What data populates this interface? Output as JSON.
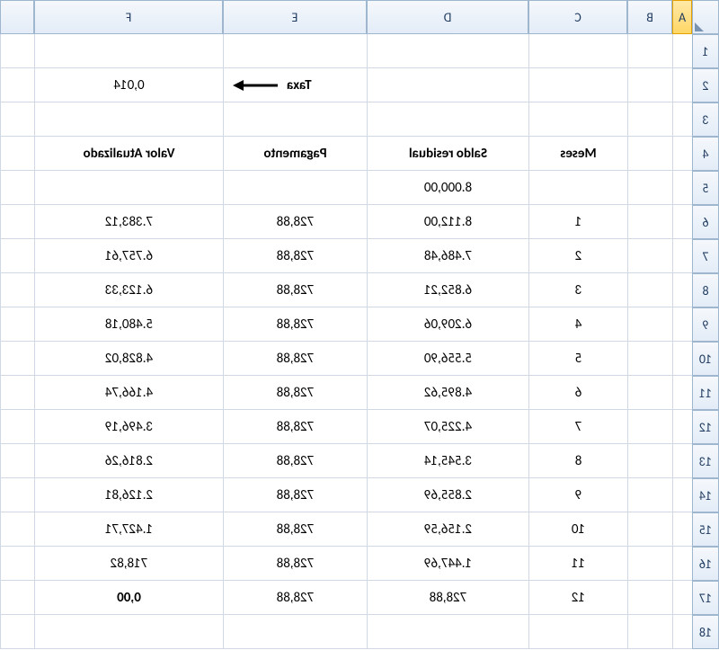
{
  "columns": [
    "A",
    "B",
    "C",
    "D",
    "E",
    "F",
    ""
  ],
  "rows": [
    "1",
    "2",
    "3",
    "4",
    "5",
    "6",
    "7",
    "8",
    "9",
    "10",
    "11",
    "12",
    "13",
    "14",
    "15",
    "16",
    "17",
    "18"
  ],
  "taxa_label": "Taxa",
  "taxa_value": "0,014",
  "headers": {
    "c": "Meses",
    "d": "Saldo residual",
    "e": "Pagamento",
    "f": "Valor Atualizado"
  },
  "data": [
    {
      "c": "",
      "d": "8.000,00",
      "e": "",
      "f": ""
    },
    {
      "c": "1",
      "d": "8.112,00",
      "e": "728,88",
      "f": "7.383,12"
    },
    {
      "c": "2",
      "d": "7.486,48",
      "e": "728,88",
      "f": "6.757,61"
    },
    {
      "c": "3",
      "d": "6.852,21",
      "e": "728,88",
      "f": "6.123,33"
    },
    {
      "c": "4",
      "d": "6.209,06",
      "e": "728,88",
      "f": "5.480,18"
    },
    {
      "c": "5",
      "d": "5.556,90",
      "e": "728,88",
      "f": "4.828,02"
    },
    {
      "c": "6",
      "d": "4.895,62",
      "e": "728,88",
      "f": "4.166,74"
    },
    {
      "c": "7",
      "d": "4.225,07",
      "e": "728,88",
      "f": "3.496,19"
    },
    {
      "c": "8",
      "d": "3.545,14",
      "e": "728,88",
      "f": "2.816,26"
    },
    {
      "c": "9",
      "d": "2.855,69",
      "e": "728,88",
      "f": "2.126,81"
    },
    {
      "c": "10",
      "d": "2.156,59",
      "e": "728,88",
      "f": "1.427,71"
    },
    {
      "c": "11",
      "d": "1.447,69",
      "e": "728,88",
      "f": "718,82"
    },
    {
      "c": "12",
      "d": "728,88",
      "e": "728,88",
      "f": "0,00",
      "fbold": true
    }
  ]
}
